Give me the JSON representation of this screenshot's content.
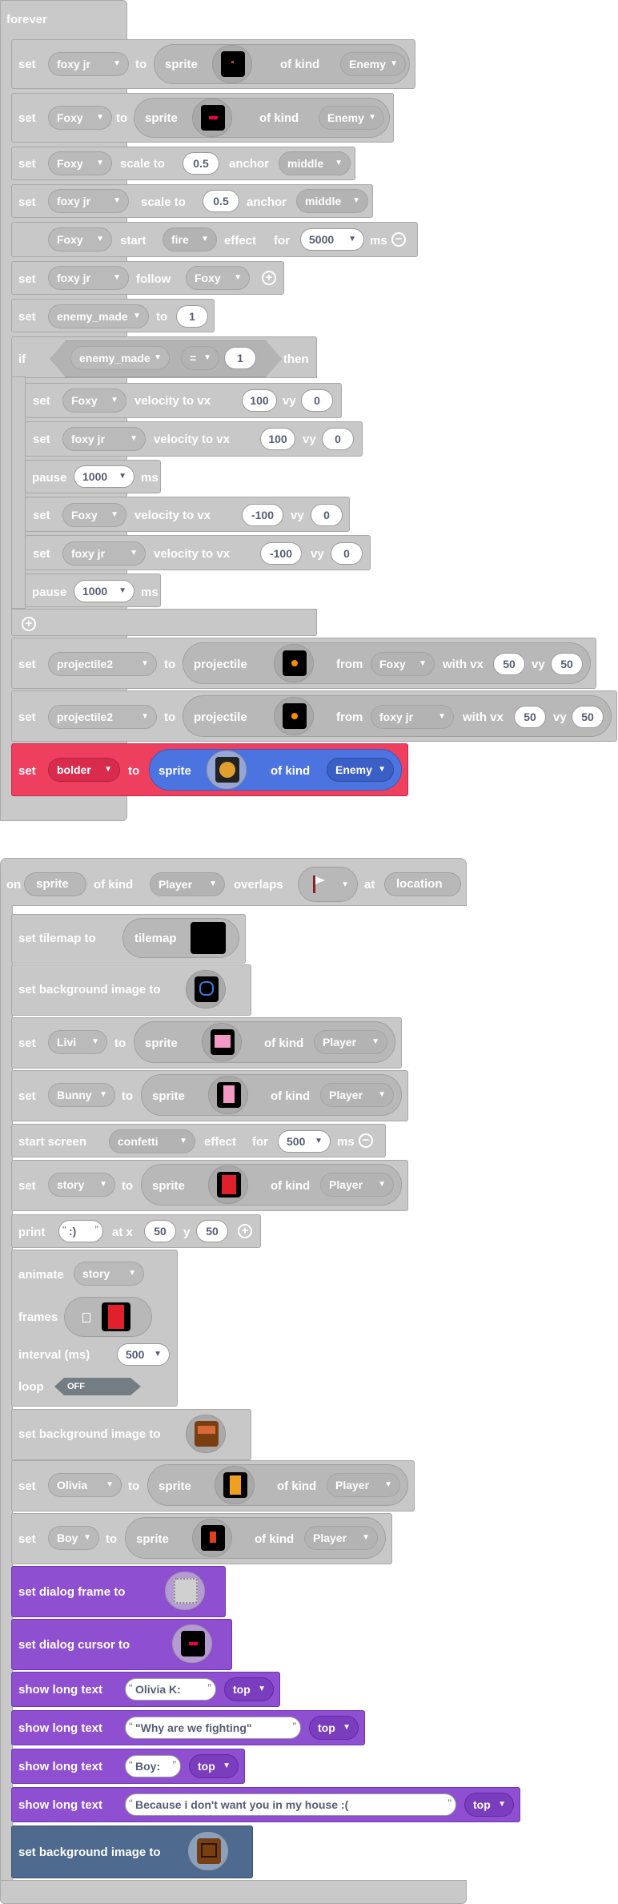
{
  "forever": {
    "hat": "forever",
    "set": "set",
    "to": "to",
    "sprite": "sprite",
    "of_kind": "of kind",
    "scale_to": "scale to",
    "anchor": "anchor",
    "start": "start",
    "effect": "effect",
    "for": "for",
    "ms": "ms",
    "follow": "follow",
    "if": "if",
    "then": "then",
    "velocity_to_vx": "velocity to vx",
    "vy": "vy",
    "pause": "pause",
    "projectile": "projectile",
    "from": "from",
    "with_vx": "with vx",
    "b1": {
      "var": "foxy jr",
      "kind": "Enemy"
    },
    "b2": {
      "var": "Foxy",
      "kind": "Enemy"
    },
    "b3": {
      "var": "Foxy",
      "scale": "0.5",
      "anchor": "middle"
    },
    "b4": {
      "var": "foxy jr",
      "scale": "0.5",
      "anchor": "middle"
    },
    "b5": {
      "var": "Foxy",
      "effect": "fire",
      "ms": "5000"
    },
    "b6": {
      "var": "foxy jr",
      "target": "Foxy"
    },
    "b7": {
      "var": "enemy_made",
      "value": "1"
    },
    "cond": {
      "var": "enemy_made",
      "op": "=",
      "value": "1"
    },
    "i1": {
      "var": "Foxy",
      "vx": "100",
      "vy": "0"
    },
    "i2": {
      "var": "foxy jr",
      "vx": "100",
      "vy": "0"
    },
    "i3": {
      "ms": "1000"
    },
    "i4": {
      "var": "Foxy",
      "vx": "-100",
      "vy": "0"
    },
    "i5": {
      "var": "foxy jr",
      "vx": "-100",
      "vy": "0"
    },
    "i6": {
      "ms": "1000"
    },
    "p1": {
      "var": "projectile2",
      "from": "Foxy",
      "vx": "50",
      "vy": "50"
    },
    "p2": {
      "var": "projectile2",
      "from": "foxy jr",
      "vx": "50",
      "vy": "50"
    },
    "b8": {
      "var": "bolder",
      "kind": "Enemy"
    }
  },
  "overlap": {
    "on": "on",
    "sprite": "sprite",
    "of_kind": "of kind",
    "kind": "Player",
    "overlaps": "overlaps",
    "at": "at",
    "location": "location",
    "set_tilemap_to": "set tilemap to",
    "tilemap": "tilemap",
    "set_bg_image": "set background image to",
    "set": "set",
    "to": "to",
    "sprite_lbl": "sprite",
    "of_kind_lbl": "of kind",
    "livi": {
      "var": "Livi",
      "kind": "Player"
    },
    "bunny": {
      "var": "Bunny",
      "kind": "Player"
    },
    "start_screen": "start screen",
    "confetti": "confetti",
    "effect": "effect",
    "for": "for",
    "ms_val": "500",
    "ms": "ms",
    "story": {
      "var": "story",
      "kind": "Player"
    },
    "print": "print",
    "print_text": ":)",
    "at_x": "at x",
    "x_val": "50",
    "y": "y",
    "y_val": "50",
    "animate": "animate",
    "anim_var": "story",
    "frames": "frames",
    "interval": "interval (ms)",
    "interval_val": "500",
    "loop": "loop",
    "loop_val": "OFF",
    "olivia": {
      "var": "Olivia",
      "kind": "Player"
    },
    "boy": {
      "var": "Boy",
      "kind": "Player"
    },
    "set_dialog_frame": "set dialog frame to",
    "set_dialog_cursor": "set dialog cursor to",
    "show_long_text": "show long text",
    "texts": [
      {
        "text": "Olivia K:",
        "pos": "top"
      },
      {
        "text": "\"Why are we fighting\"",
        "pos": "top"
      },
      {
        "text": "Boy:",
        "pos": "top"
      },
      {
        "text": " Because i don't want you in my house :(",
        "pos": "top"
      }
    ]
  }
}
